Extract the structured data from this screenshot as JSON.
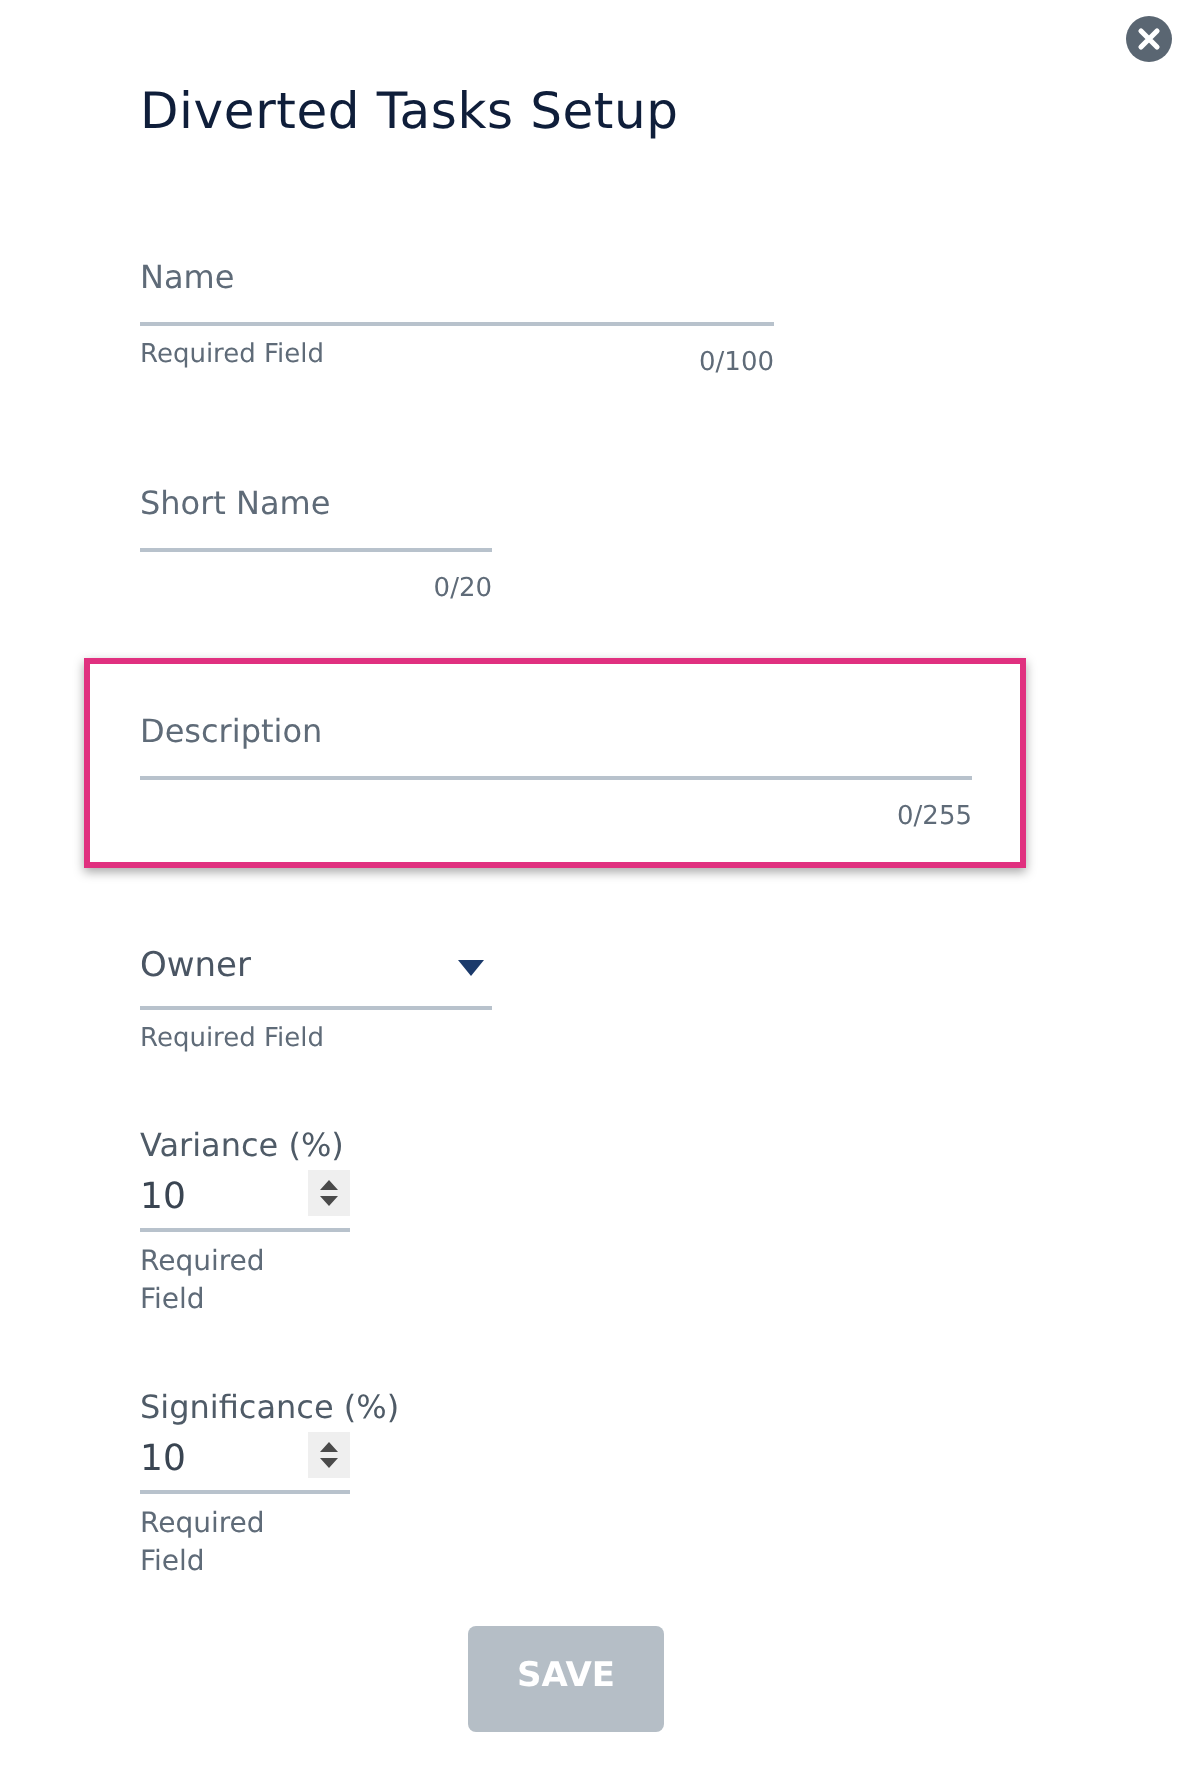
{
  "dialog": {
    "title": "Diverted Tasks Setup"
  },
  "fields": [
    {
      "kind": "text",
      "placeholder": "Name",
      "hint": "Required Field",
      "counter": "0/100",
      "highlighted": false
    },
    {
      "kind": "text",
      "placeholder": "Short Name",
      "counter": "0/20",
      "highlighted": false
    },
    {
      "kind": "text",
      "placeholder": "Description",
      "counter": "0/255",
      "highlighted": true
    },
    {
      "kind": "select",
      "placeholder": "Owner",
      "hint": "Required Field"
    },
    {
      "kind": "number",
      "label": "Variance (%)",
      "value": "10",
      "hint": "Required Field"
    },
    {
      "kind": "number",
      "label": "Significance (%)",
      "value": "10",
      "hint": "Required Field"
    }
  ],
  "save_button": {
    "label": "SAVE",
    "disabled": true
  }
}
